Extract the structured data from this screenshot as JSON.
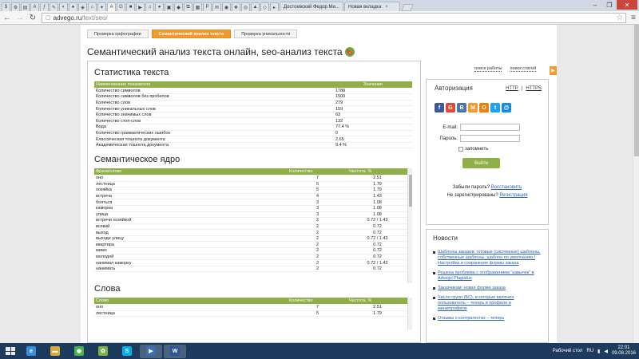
{
  "browser": {
    "pinned_tabs": [
      "$",
      "⚙",
      "▤",
      "A",
      "ƒ",
      "✎",
      "◐",
      "♠",
      "◈",
      "⌂",
      "✦",
      "A",
      "G",
      "■",
      "▶",
      "♫",
      "●",
      "▣",
      "◆",
      "⧉",
      "▦",
      "P",
      "✉",
      "◉",
      "❖",
      "◎",
      "▲",
      "◇",
      "▸"
    ],
    "tabs": [
      {
        "label": "Достоевский Федор Ми...",
        "close": "×"
      },
      {
        "label": "Новая вкладка",
        "close": "×"
      }
    ],
    "window_buttons": {
      "minimize": "–",
      "maximize": "❐",
      "close": "✕"
    },
    "nav": {
      "back": "←",
      "forward": "→",
      "reload": "↻",
      "star": "☆",
      "menu": "≡"
    },
    "address": {
      "host": "advego.ru",
      "path": "/text/seo/"
    }
  },
  "page_tabs": [
    "Проверка орфографии",
    "Семантический анализ текста",
    "Проверка уникальности"
  ],
  "page_title": "Семантический анализ текста онлайн, seo-анализ текста",
  "bookmark_icon": "🔖",
  "top_links": [
    "поиск работы",
    "поиск статей"
  ],
  "side_button": "▶",
  "stats": {
    "heading": "Статистика текста",
    "col_name": "Наименование показателя",
    "col_value": "Значение",
    "rows": [
      {
        "name": "Количество символов",
        "value": "1780"
      },
      {
        "name": "Количество символов без пробелов",
        "value": "1500"
      },
      {
        "name": "Количество слов",
        "value": "279"
      },
      {
        "name": "Количество уникальных слов",
        "value": "159"
      },
      {
        "name": "Количество значимых слов",
        "value": "63"
      },
      {
        "name": "Количество стоп-слов",
        "value": "132"
      },
      {
        "name": "Вода",
        "value": "77.4 %"
      },
      {
        "name": "Количество грамматических ошибок",
        "value": "0"
      },
      {
        "name": "Классическая тошнота документа",
        "value": "2.65"
      },
      {
        "name": "Академическая тошнота документа",
        "value": "9.4 %"
      }
    ]
  },
  "core": {
    "heading": "Семантическое ядро",
    "col_phrase": "Фраза/слово",
    "col_count": "Количество",
    "col_freq": "Частота, %",
    "rows": [
      {
        "p": "оно",
        "c": "7",
        "f": "2.51"
      },
      {
        "p": "лестница",
        "c": "5",
        "f": "1.79"
      },
      {
        "p": "хозяйка",
        "c": "5",
        "f": "1.79"
      },
      {
        "p": "встреча",
        "c": "4",
        "f": "1.43"
      },
      {
        "p": "бояться",
        "c": "3",
        "f": "1.08"
      },
      {
        "p": "каморка",
        "c": "3",
        "f": "1.08"
      },
      {
        "p": "улица",
        "c": "3",
        "f": "1.08"
      },
      {
        "p": "встречи хозяйкой",
        "c": "2",
        "f": "0.72 / 1.43"
      },
      {
        "p": "всякий",
        "c": "2",
        "f": "0.72"
      },
      {
        "p": "выход",
        "c": "2",
        "f": "0.72"
      },
      {
        "p": "выходе улицу",
        "c": "2",
        "f": "0.72 / 1.43"
      },
      {
        "p": "квартира",
        "c": "2",
        "f": "0.72"
      },
      {
        "p": "мимо",
        "c": "2",
        "f": "0.72"
      },
      {
        "p": "молодой",
        "c": "2",
        "f": "0.72"
      },
      {
        "p": "нанимал каморку",
        "c": "2",
        "f": "0.72 / 1.43"
      },
      {
        "p": "нанимать",
        "c": "2",
        "f": "0.72"
      }
    ]
  },
  "words": {
    "heading": "Слова",
    "col_word": "Слово",
    "col_count": "Количество",
    "col_freq": "Частота, %",
    "rows": [
      {
        "p": "оно",
        "c": "7",
        "f": "2.51"
      },
      {
        "p": "лестница",
        "c": "5",
        "f": "1.79"
      }
    ]
  },
  "auth": {
    "title": "Авторизация",
    "http": "HTTP",
    "sep": "|",
    "https": "HTTPS",
    "socials": [
      {
        "glyph": "f",
        "color": "#3b5998"
      },
      {
        "glyph": "G",
        "color": "#dd4b39"
      },
      {
        "glyph": "В",
        "color": "#4c75a3"
      },
      {
        "glyph": "М",
        "color": "#f29a2e"
      },
      {
        "glyph": "О",
        "color": "#ee8208"
      },
      {
        "glyph": "t",
        "color": "#1da1f2"
      },
      {
        "glyph": "@",
        "color": "#168de2"
      }
    ],
    "email_label": "E-mail:",
    "password_label": "Пароль:",
    "remember": "запомнить",
    "login_button": "Войти",
    "forgot_q": "Забыли пароль?",
    "forgot_link": "Восстановить",
    "notreg_q": "Не зарегистрированы?",
    "reg_link": "Регистрация"
  },
  "news": {
    "title": "Новости",
    "items": [
      "Шаблоны заказов: готовые (системные) шаблоны, собственные шаблоны, шаблон по умолчанию / Настройка и сохранение формы заказа",
      "Решена проблема с отображением \"кавычек\" в Advego Plagiatus",
      "Заказчикам: новая форма заказа",
      "Число групп (БС), в которые включен пользователь – теперь в профиле и миниπрофиле",
      "Отзывы о контрагентах – теперь"
    ]
  },
  "taskbar": {
    "apps": [
      {
        "glyph": "e",
        "color": "#3a8be0"
      },
      {
        "glyph": "▬",
        "color": "#d9a93c"
      },
      {
        "glyph": "◉",
        "color": "#4caf50"
      },
      {
        "glyph": "✿",
        "color": "#7cb342"
      },
      {
        "glyph": "S",
        "color": "#00aff0"
      },
      {
        "glyph": "▶",
        "color": "#3a6fb0"
      },
      {
        "glyph": "W",
        "color": "#2b579a"
      }
    ],
    "desktop_label": "Рабочий стол",
    "lang": "RU",
    "time": "22:01",
    "date": "09.08.2016"
  }
}
